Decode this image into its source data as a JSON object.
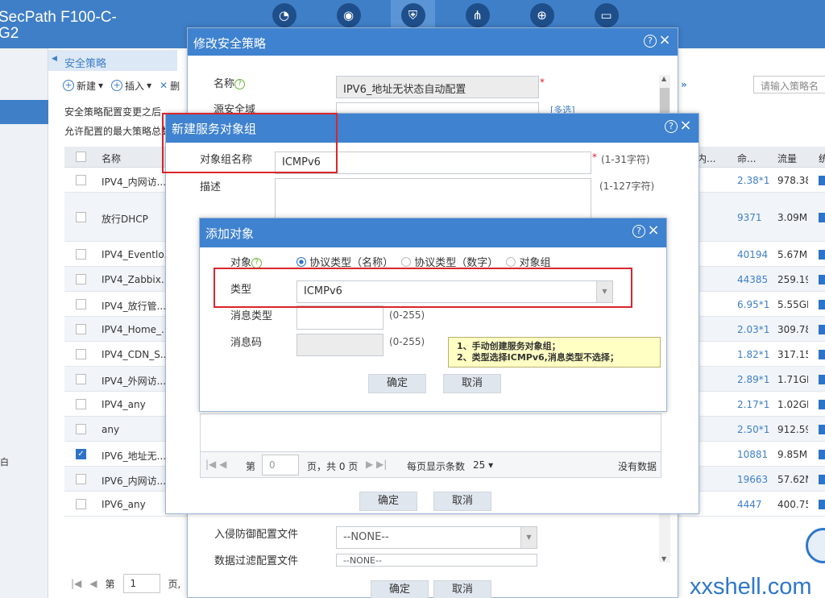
{
  "brand": {
    "line1": "SecPath F100-C-",
    "line2": "G2"
  },
  "top_icons": [
    "dashboard-icon",
    "monitor-icon",
    "shield-icon",
    "network-icon",
    "globe-icon",
    "system-icon"
  ],
  "sidebar": {
    "label": "白"
  },
  "bg": {
    "tab": "安全策略",
    "toolbar": {
      "new": "新建",
      "insert": "插入",
      "del": "删"
    },
    "info1": "安全策略配置变更之后",
    "info2": "允许配置的最大策略总数",
    "search_placeholder": "请输入策略名",
    "dbl_arrow": "»",
    "columns": {
      "name": "名称",
      "internal": "内...",
      "hits": "命...",
      "traffic": "流量",
      "stats": "统"
    },
    "rows": [
      {
        "name": "IPV4_内网访...",
        "hits": "2.38*1",
        "traffic": "978.38",
        "checked": false
      },
      {
        "name": "放行DHCP",
        "hits": "9371",
        "traffic": "3.09M",
        "checked": false
      },
      {
        "name": "IPV4_Eventlo...",
        "hits": "40194",
        "traffic": "5.67M",
        "checked": false
      },
      {
        "name": "IPV4_Zabbix...",
        "hits": "44385",
        "traffic": "259.19",
        "checked": false
      },
      {
        "name": "IPV4_放行管...",
        "hits": "6.95*1",
        "traffic": "5.55GE",
        "checked": false
      },
      {
        "name": "IPV4_Home_...",
        "hits": "2.03*1",
        "traffic": "309.78",
        "checked": false
      },
      {
        "name": "IPV4_CDN_S...",
        "hits": "1.82*1",
        "traffic": "317.15",
        "checked": false
      },
      {
        "name": "IPV4_外网访...",
        "hits": "2.89*1",
        "traffic": "1.71GE",
        "checked": false
      },
      {
        "name": "IPV4_any",
        "hits": "2.17*1",
        "traffic": "1.02GE",
        "checked": false
      },
      {
        "name": "any",
        "hits": "2.50*1",
        "traffic": "912.59",
        "checked": false
      },
      {
        "name": "IPV6_地址无...",
        "hits": "10881",
        "traffic": "9.85M",
        "checked": true
      },
      {
        "name": "IPV6_内网访...",
        "hits": "19663",
        "traffic": "57.62M",
        "checked": false
      },
      {
        "name": "IPV6_any",
        "hits": "4447",
        "traffic": "400.75",
        "checked": false
      }
    ],
    "pager": {
      "page_label": "第",
      "page_value": "1",
      "page_suffix": "页,"
    }
  },
  "dlg1": {
    "title": "修改安全策略",
    "name_label": "名称",
    "name_value": "IPV6_地址无状态自动配置",
    "required": "*",
    "src_zone_label": "源安全域",
    "multi_select": "[多选]",
    "ips_label": "入侵防御配置文件",
    "ips_value": "--NONE--",
    "dfilter_label": "数据过滤配置文件",
    "dfilter_value": "--NONE--",
    "ok": "确定",
    "cancel": "取消"
  },
  "dlg2": {
    "title": "新建服务对象组",
    "group_name_label": "对象组名称",
    "group_name_value": "ICMPv6",
    "group_name_hint": "(1-31字符)",
    "desc_label": "描述",
    "desc_hint": "(1-127字符)",
    "pager": {
      "page_label": "第",
      "page_value": "0",
      "page_suffix": "页，共 0 页",
      "per_page_label": "每页显示条数",
      "per_page_value": "25",
      "no_data": "没有数据"
    },
    "ok": "确定",
    "cancel": "取消"
  },
  "dlg3": {
    "title": "添加对象",
    "object_label": "对象",
    "radio_options": [
      "协议类型（名称）",
      "协议类型（数字）",
      "对象组"
    ],
    "type_label": "类型",
    "type_value": "ICMPv6",
    "msg_type_label": "消息类型",
    "msg_type_hint": "(0-255)",
    "msg_code_label": "消息码",
    "msg_code_hint": "(0-255)",
    "ok": "确定",
    "cancel": "取消"
  },
  "note": {
    "line1": "1、手动创建服务对象组；",
    "line2": "2、类型选择ICMPv6,消息类型不选择；"
  },
  "watermark": "xxshell.com",
  "colors": {
    "header": "#3f82cf",
    "topbar": "#3f7fc7",
    "annotation_red": "#d9262c",
    "note_bg": "#ffffc4"
  }
}
